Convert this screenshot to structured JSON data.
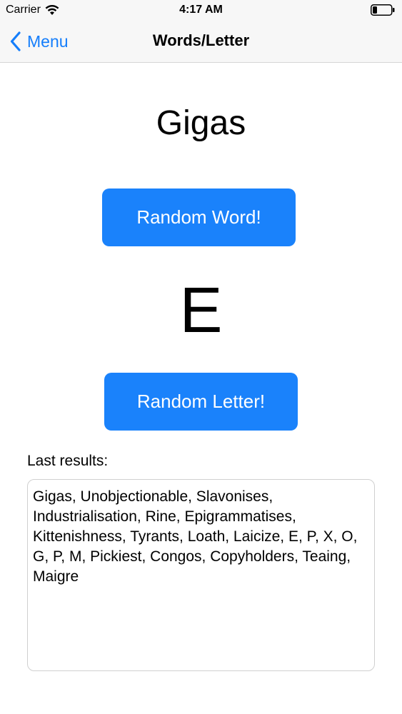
{
  "status_bar": {
    "carrier": "Carrier",
    "time": "4:17 AM"
  },
  "nav": {
    "back_label": "Menu",
    "title": "Words/Letter"
  },
  "main": {
    "word": "Gigas",
    "random_word_button": "Random Word!",
    "letter": "E",
    "random_letter_button": "Random Letter!",
    "last_results_label": "Last results:",
    "last_results_text": "Gigas, Unobjectionable, Slavonises, Industrialisation, Rine, Epigrammatises, Kittenishness, Tyrants, Loath, Laicize, E, P, X, O, G, P, M, Pickiest, Congos, Copyholders, Teaing, Maigre"
  },
  "colors": {
    "accent": "#157efb",
    "button_bg": "#1a82fb"
  },
  "icons": {
    "wifi": "wifi-icon",
    "battery": "battery-icon",
    "back": "chevron-left-icon"
  }
}
